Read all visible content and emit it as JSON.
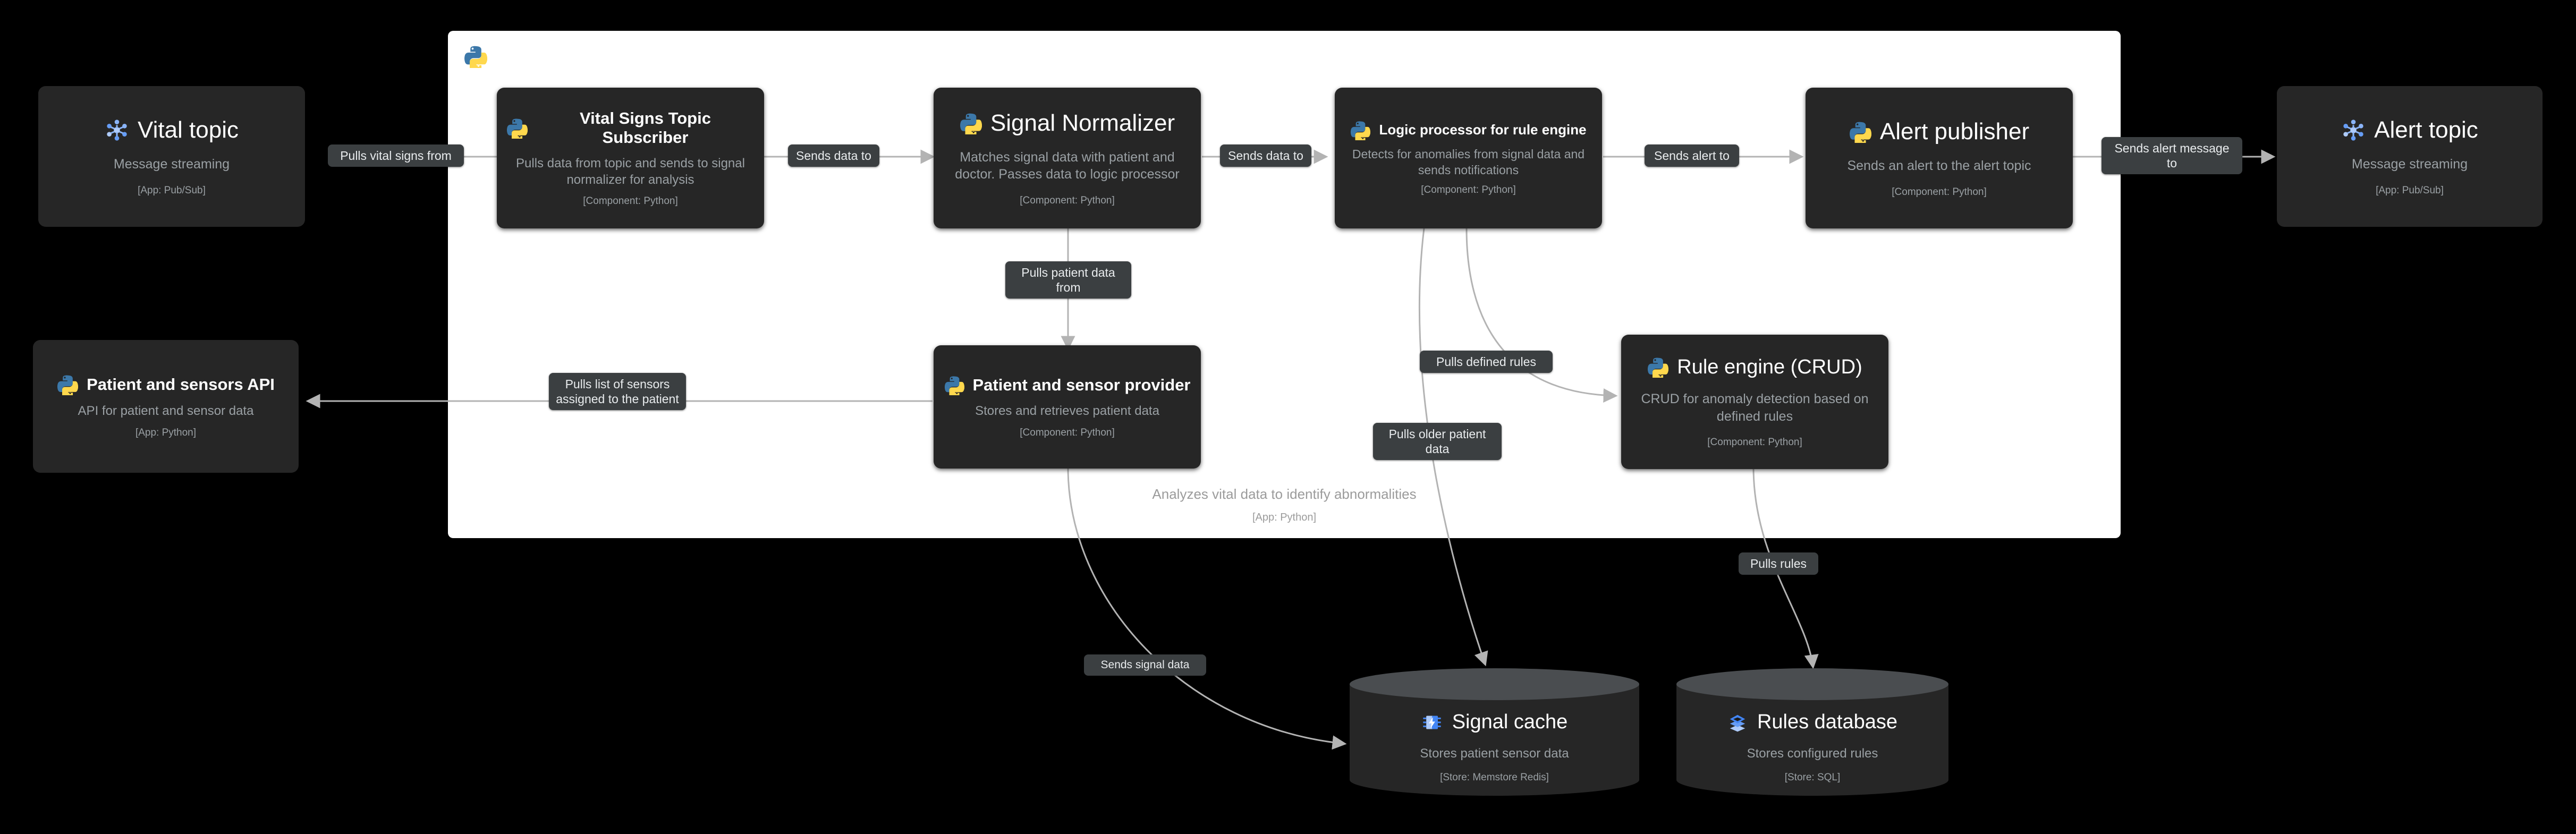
{
  "container": {
    "name": "Analyzes vital data to identify abnormalities",
    "description": "Analyzes vital data to identify abnormalities",
    "technology": "[App: Python]",
    "icon": "python-icon"
  },
  "nodes": [
    {
      "id": "vital-topic",
      "title": "Vital topic",
      "description": "Message streaming",
      "technology": "[App: Pub/Sub]",
      "icon": "pubsub-icon",
      "shape": "box"
    },
    {
      "id": "vital-signs-topic-subscriber",
      "title": "Vital Signs Topic Subscriber",
      "description": "Pulls data from topic and sends to signal normalizer for analysis",
      "technology": "[Component: Python]",
      "icon": "python-icon",
      "shape": "box"
    },
    {
      "id": "signal-normalizer",
      "title": "Signal Normalizer",
      "description": "Matches signal data with patient and doctor. Passes data to logic processor",
      "technology": "[Component: Python]",
      "icon": "python-icon",
      "shape": "box"
    },
    {
      "id": "logic-processor-for-rule-engine",
      "title": "Logic processor for rule engine",
      "description": "Detects for anomalies from signal data and sends notifications",
      "technology": "[Component: Python]",
      "icon": "python-icon",
      "shape": "box"
    },
    {
      "id": "alert-publisher",
      "title": "Alert publisher",
      "description": "Sends an alert to the alert topic",
      "technology": "[Component: Python]",
      "icon": "python-icon",
      "shape": "box"
    },
    {
      "id": "alert-topic",
      "title": "Alert topic",
      "description": "Message streaming",
      "technology": "[App: Pub/Sub]",
      "icon": "pubsub-icon",
      "shape": "box"
    },
    {
      "id": "patient-and-sensors-api",
      "title": "Patient and sensors API",
      "description": "API for patient and sensor data",
      "technology": "[App: Python]",
      "icon": "python-icon",
      "shape": "box"
    },
    {
      "id": "patient-and-sensor-provider",
      "title": "Patient and sensor provider",
      "description": "Stores and retrieves patient data",
      "technology": "[Component: Python]",
      "icon": "python-icon",
      "shape": "box"
    },
    {
      "id": "rule-engine-crud",
      "title": "Rule engine (CRUD)",
      "description": "CRUD for anomaly detection based on defined rules",
      "technology": "[Component: Python]",
      "icon": "python-icon",
      "shape": "box"
    },
    {
      "id": "signal-cache",
      "title": "Signal cache",
      "description": "Stores patient sensor data",
      "technology": "[Store: Memstore Redis]",
      "icon": "memory-chip-icon",
      "shape": "cylinder"
    },
    {
      "id": "rules-database",
      "title": "Rules database",
      "description": "Stores configured rules",
      "technology": "[Store: SQL]",
      "icon": "database-layers-icon",
      "shape": "cylinder"
    }
  ],
  "edges": [
    {
      "id": "e1",
      "label": "Pulls vital signs from",
      "from": "vital-signs-topic-subscriber",
      "to": "vital-topic"
    },
    {
      "id": "e2",
      "label": "Sends data to",
      "from": "vital-signs-topic-subscriber",
      "to": "signal-normalizer"
    },
    {
      "id": "e3",
      "label": "Sends data to",
      "from": "signal-normalizer",
      "to": "logic-processor-for-rule-engine"
    },
    {
      "id": "e4",
      "label": "Sends alert to",
      "from": "logic-processor-for-rule-engine",
      "to": "alert-publisher"
    },
    {
      "id": "e5",
      "label": "Sends alert message to",
      "from": "alert-publisher",
      "to": "alert-topic"
    },
    {
      "id": "e6",
      "label": "Pulls patient data from",
      "from": "signal-normalizer",
      "to": "patient-and-sensor-provider"
    },
    {
      "id": "e7",
      "label": "Pulls list of sensors assigned to the patient",
      "from": "patient-and-sensor-provider",
      "to": "patient-and-sensors-api"
    },
    {
      "id": "e8",
      "label": "Pulls defined rules",
      "from": "logic-processor-for-rule-engine",
      "to": "rule-engine-crud"
    },
    {
      "id": "e9",
      "label": "Pulls older patient data",
      "from": "logic-processor-for-rule-engine",
      "to": "signal-cache"
    },
    {
      "id": "e10",
      "label": "Sends signal data",
      "from": "patient-and-sensor-provider",
      "to": "signal-cache"
    },
    {
      "id": "e11",
      "label": "Pulls rules",
      "from": "rule-engine-crud",
      "to": "rules-database"
    }
  ],
  "colors": {
    "background": "#000000",
    "container": "#ffffff",
    "node": "#262626",
    "edge": "#b3b3b3",
    "label_bg": "#3b3f41",
    "title_text": "#ffffff",
    "desc_text": "#9aa0a4",
    "pubsub_icon": "#8ab4f8",
    "store_icon": "#669df6",
    "python_blue": "#3c78a9",
    "python_yellow": "#ffd84d"
  }
}
